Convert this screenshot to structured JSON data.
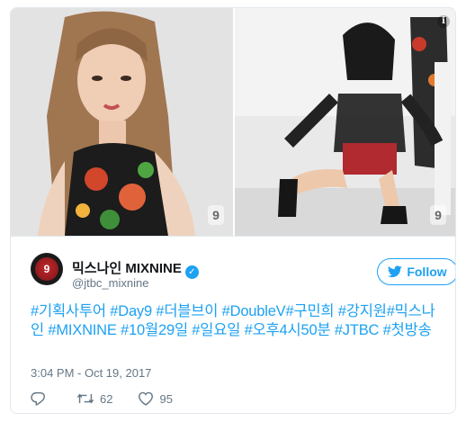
{
  "tweet": {
    "display_name": "믹스나인 MIXNINE",
    "handle": "@jtbc_mixnine",
    "avatar_label": "9",
    "follow_label": "Follow",
    "text": "#기획사투어 #Day9 #더블브이 #DoubleV#구민희 #강지원#믹스나인 #MIXNINE #10월29일 #일요일 #오후4시50분 #JTBC #첫방송",
    "timestamp": "3:04 PM - Oct 19, 2017",
    "replies": "",
    "retweets": "62",
    "likes": "95"
  },
  "media": {
    "watermark": "9",
    "info_glyph": "i"
  },
  "colors": {
    "accent": "#1da1f2",
    "secondary_text": "#657786",
    "primary_text": "#14171a",
    "border": "#e1e8ed"
  },
  "icons": [
    "verified-badge-icon",
    "twitter-bird-icon",
    "reply-icon",
    "retweet-icon",
    "like-heart-icon",
    "info-icon"
  ]
}
